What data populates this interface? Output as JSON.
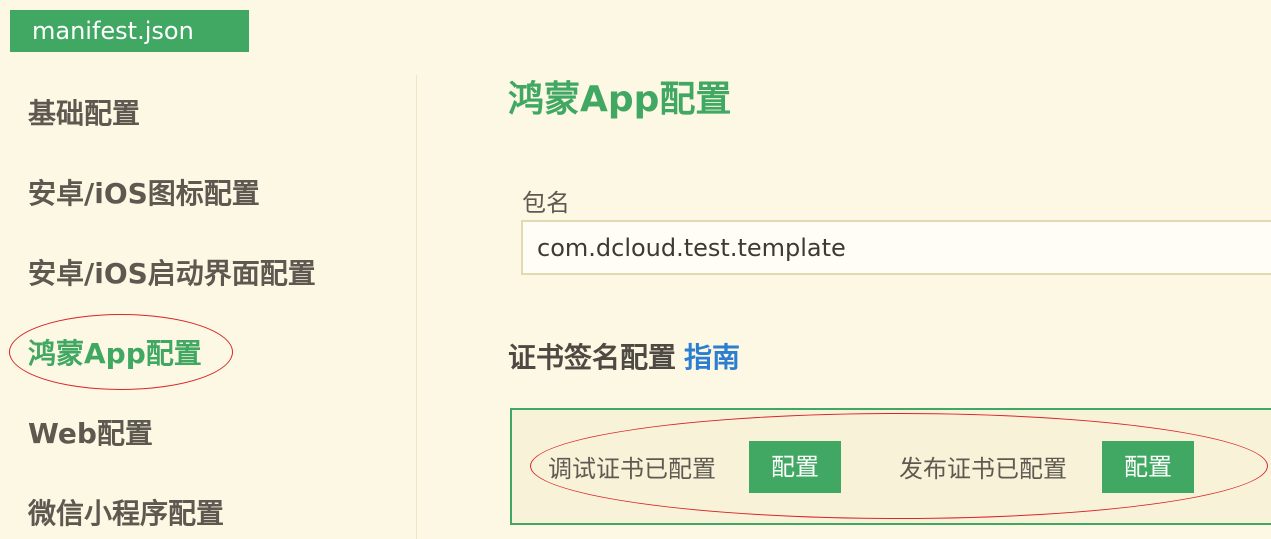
{
  "file_tab": {
    "label": "manifest.json"
  },
  "sidebar": {
    "items": [
      {
        "label": "基础配置"
      },
      {
        "label": "安卓/iOS图标配置"
      },
      {
        "label": "安卓/iOS启动界面配置"
      },
      {
        "label": "鸿蒙App配置",
        "active": true
      },
      {
        "label": "Web配置"
      },
      {
        "label": "微信小程序配置"
      }
    ]
  },
  "main": {
    "title": "鸿蒙App配置",
    "package_name": {
      "label": "包名",
      "value": "com.dcloud.test.template"
    },
    "cert_section": {
      "title": "证书签名配置",
      "guide_link": "指南",
      "debug_label": "调试证书已配置",
      "debug_button": "配置",
      "release_label": "发布证书已配置",
      "release_button": "配置"
    }
  },
  "colors": {
    "accent_green": "#41a863",
    "link_blue": "#2c7fd0",
    "annotation_red": "#d8262a",
    "background": "#fdf8e4"
  }
}
